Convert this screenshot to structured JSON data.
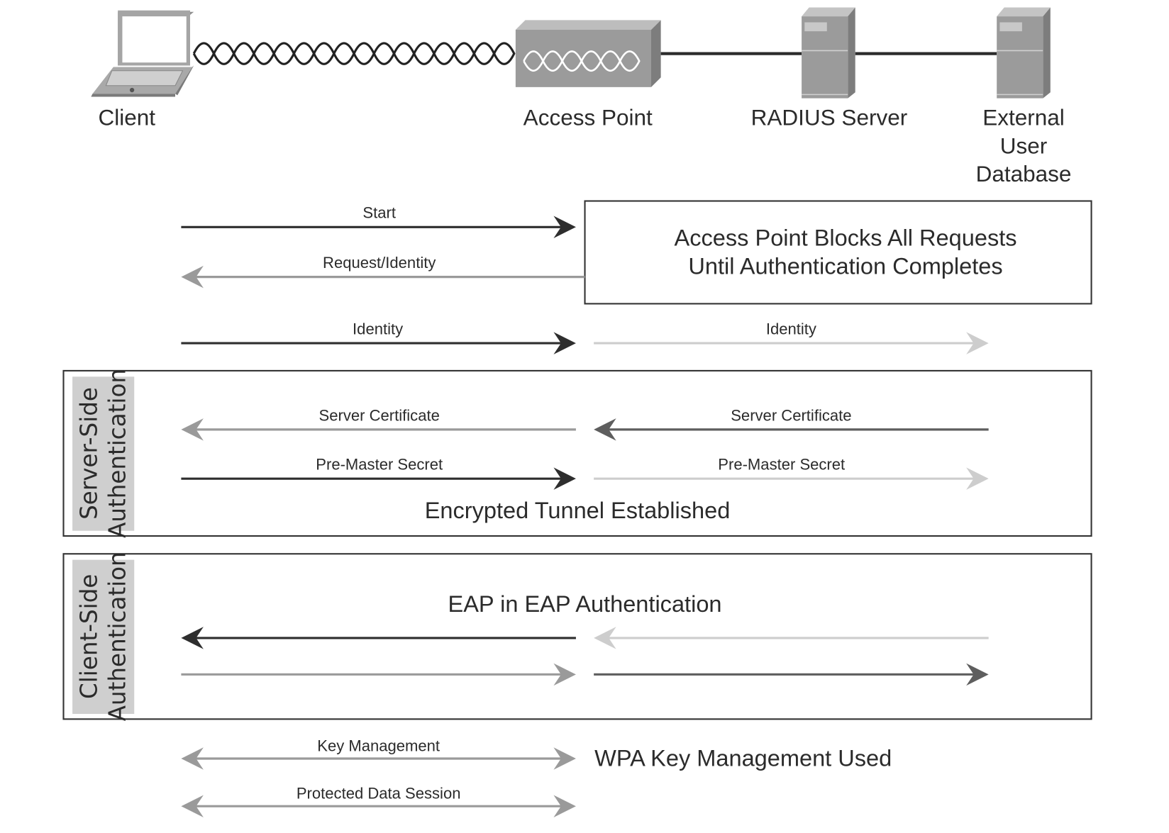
{
  "devices": {
    "client": "Client",
    "access_point": "Access Point",
    "radius_server": "RADIUS Server",
    "external_db": [
      "External",
      "User",
      "Database"
    ]
  },
  "notes": {
    "ap_blocks": [
      "Access Point Blocks All Requests",
      "Until Authentication Completes"
    ],
    "tunnel": "Encrypted Tunnel Established",
    "eap": "EAP in EAP Authentication",
    "wpa": "WPA Key Management Used"
  },
  "sections": {
    "server_side": [
      "Server-Side",
      "Authentication"
    ],
    "client_side": [
      "Client-Side",
      "Authentication"
    ]
  },
  "messages": {
    "start": "Start",
    "request_identity": "Request/Identity",
    "identity_left": "Identity",
    "identity_right": "Identity",
    "server_cert_left": "Server Certificate",
    "server_cert_right": "Server Certificate",
    "pre_master_left": "Pre-Master Secret",
    "pre_master_right": "Pre-Master Secret",
    "key_management": "Key Management",
    "protected_data": "Protected Data Session"
  },
  "colors": {
    "dark": "#2e2e2e",
    "medium": "#9a9a9a",
    "medium_dark": "#5e5e5e",
    "light": "#cdcdcd",
    "device_gray": "#9b9b9b"
  }
}
